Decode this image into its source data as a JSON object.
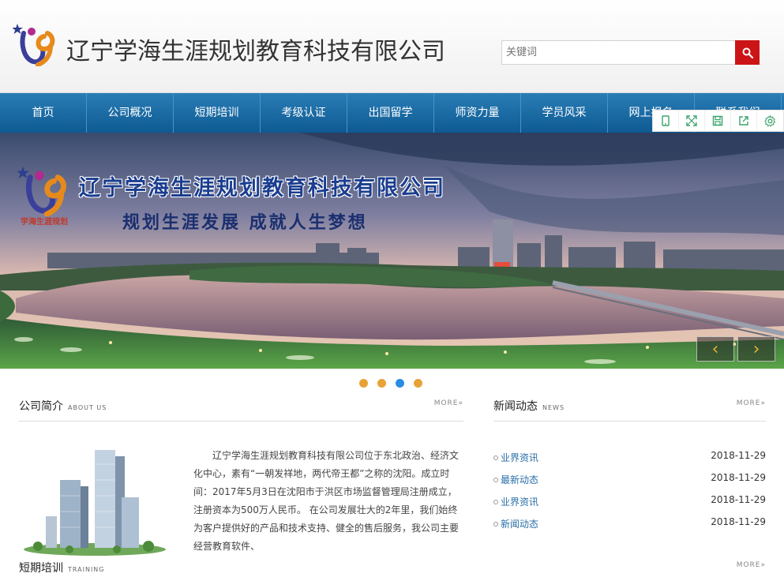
{
  "header": {
    "brand": "辽宁学海生涯规划教育科技有限公司",
    "search_placeholder": "关键词"
  },
  "nav": {
    "items": [
      "首页",
      "公司概况",
      "短期培训",
      "考级认证",
      "出国留学",
      "师资力量",
      "学员风采",
      "网上报名",
      "联系我们"
    ]
  },
  "banner": {
    "title": "辽宁学海生涯规划教育科技有限公司",
    "slogan": "规划生涯发展  成就人生梦想",
    "logo_text": "学海生涯规划",
    "prev": "‹",
    "next": "›",
    "active_slide": 3,
    "slide_count": 4
  },
  "about": {
    "title": "公司简介",
    "title_en": "ABOUT US",
    "more": "MORE»",
    "text": "辽宁学海生涯规划教育科技有限公司位于东北政治、经济文化中心，素有“一朝发祥地，两代帝王都”之称的沈阳。成立时间：2017年5月3日在沈阳市于洪区市场监督管理局注册成立，注册资本为500万人民币。 在公司发展壮大的2年里，我们始终为客户提供好的产品和技术支持、健全的售后服务，我公司主要经营教育软件、"
  },
  "news": {
    "title": "新闻动态",
    "title_en": "NEWS",
    "more": "MORE»",
    "items": [
      {
        "title": "业界资讯",
        "date": "2018-11-29"
      },
      {
        "title": "最新动态",
        "date": "2018-11-29"
      },
      {
        "title": "业界资讯",
        "date": "2018-11-29"
      },
      {
        "title": "新闻动态",
        "date": "2018-11-29"
      }
    ]
  },
  "training": {
    "title": "短期培训",
    "title_en": "TRAINING",
    "more": "MORE»"
  },
  "colors": {
    "nav": "#1a6aa4",
    "search_button": "#cc1417",
    "news_link": "#2a6fa8",
    "dot": "#e8a236",
    "dot_active": "#2b8de0"
  }
}
